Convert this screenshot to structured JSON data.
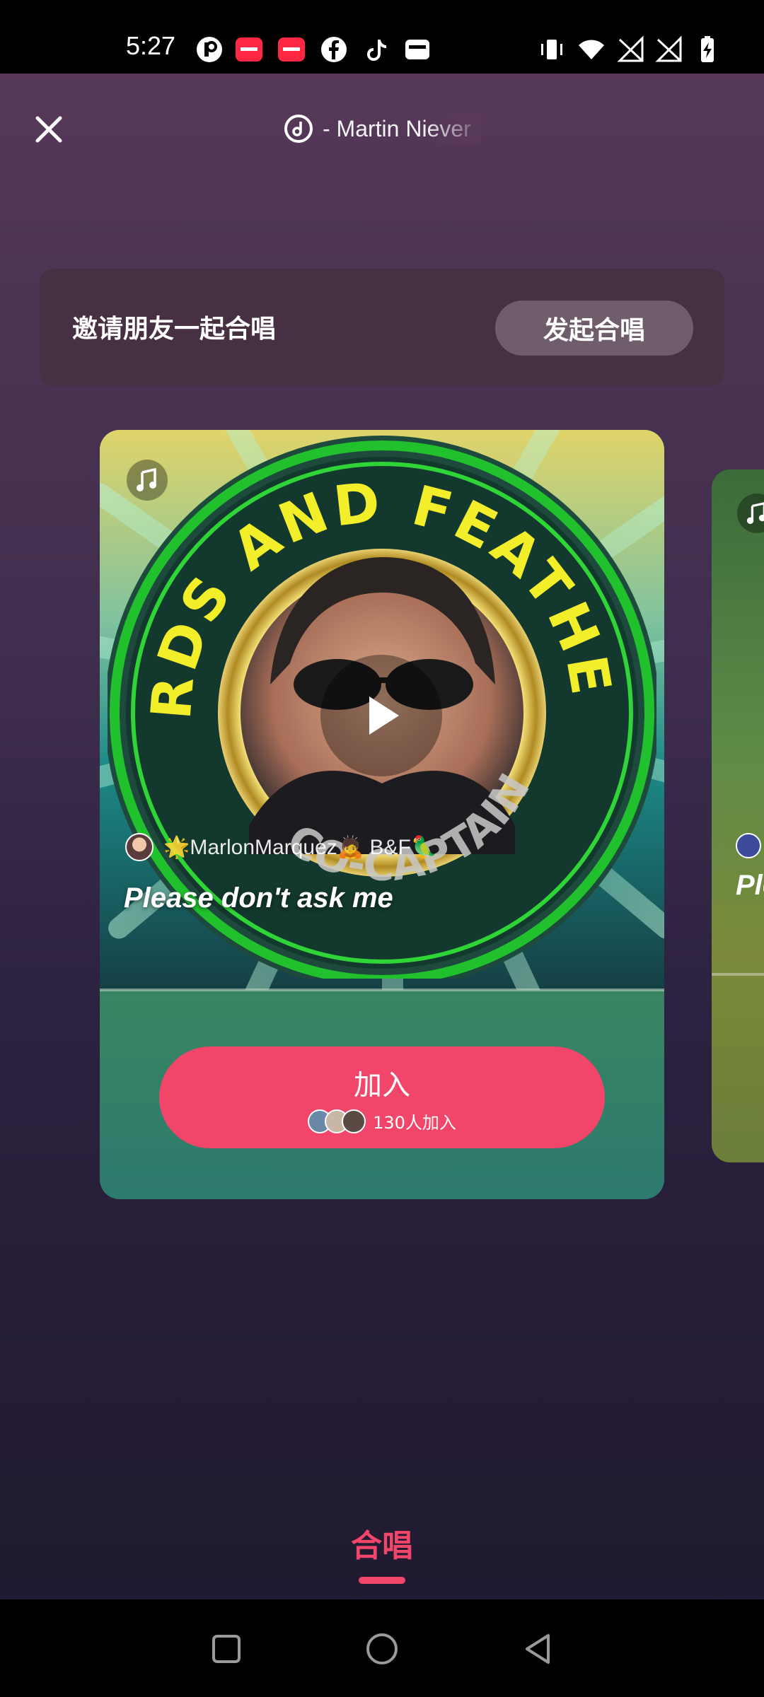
{
  "status_bar": {
    "time": "5:27",
    "left_icons": [
      "p-app-icon",
      "xiaohongshu-icon",
      "xiaohongshu-icon",
      "facebook-icon",
      "tiktok-icon",
      "wallet-icon"
    ],
    "right_icons": [
      "vibrate-icon",
      "wifi-icon",
      "signal-off-icon",
      "signal-off-icon",
      "battery-charging-icon"
    ]
  },
  "header": {
    "close_icon": "close-icon",
    "song_icon": "music-disc-icon",
    "song_title": "- Martin Niever"
  },
  "invite": {
    "text": "邀请朋友一起合唱",
    "button": "发起合唱"
  },
  "main_card": {
    "music_icon": "music-note-icon",
    "author": "🌟MarlonMarquez🙇 B&F🦜",
    "lyric": "Please don't ask me",
    "play_icon": "play-icon",
    "join_label": "加入",
    "join_count": "130人加入"
  },
  "side_card": {
    "lyric_partial": "Ple"
  },
  "bottom_tab": {
    "label": "合唱"
  },
  "colors": {
    "accent": "#f2456a",
    "status_bar": "#000000"
  }
}
